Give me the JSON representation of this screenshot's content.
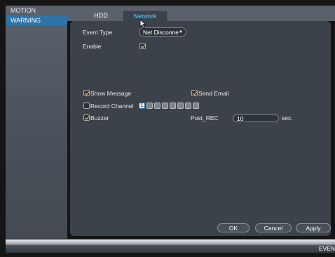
{
  "nav": {
    "items": [
      {
        "label": "MOTION",
        "active": false
      },
      {
        "label": "WARNING",
        "active": true
      }
    ]
  },
  "tabs": {
    "hdd": "HDD",
    "network": "Network"
  },
  "form": {
    "event_type_label": "Event Type",
    "event_type_value": "Net Disconne",
    "enable_label": "Enable",
    "enable_checked": true,
    "show_message_label": "Show Message",
    "show_message_checked": true,
    "send_email_label": "Send Email",
    "send_email_checked": true,
    "record_channel_label": "Record Channel",
    "record_channel_checked": false,
    "record_channel_first": "1",
    "buzzer_label": "Buzzer",
    "buzzer_checked": true,
    "post_rec_label": "Post_REC",
    "post_rec_value": "10",
    "post_rec_unit": "sec."
  },
  "buttons": {
    "ok": "OK",
    "cancel": "Cancel",
    "apply": "Apply"
  },
  "bottom": {
    "text": "EVEN"
  },
  "colors": {
    "accent": "#2d74a8",
    "active_tab_text": "#64c8ff",
    "check_mark": "#ffd27a"
  },
  "icons": {
    "cursor": "arrow-cursor-icon",
    "dropdown": "caret-down-icon",
    "checkbox": "checkbox-icon"
  }
}
